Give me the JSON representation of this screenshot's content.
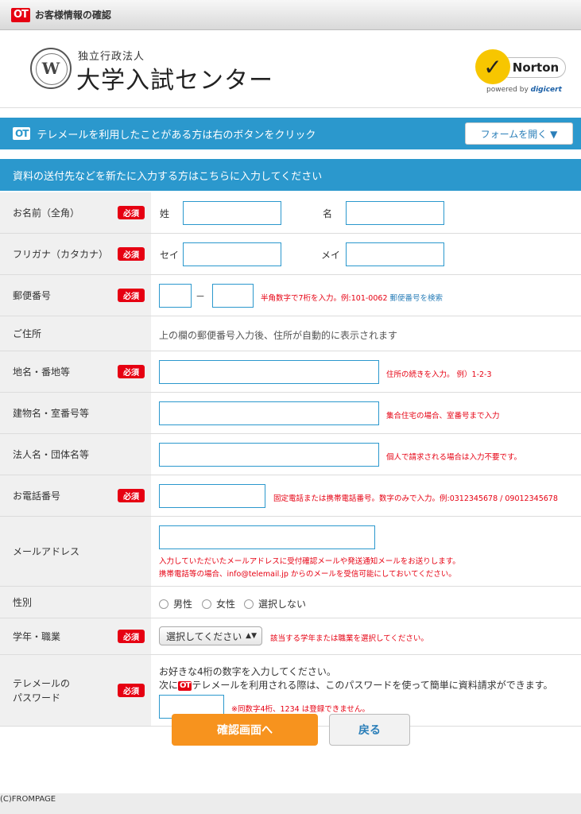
{
  "topbar": {
    "logo": "OT",
    "title": "お客様情報の確認"
  },
  "header": {
    "seal_mark": "W",
    "org_small": "独立行政法人",
    "org_big": "大学入試センター",
    "norton": {
      "name": "Norton",
      "powered": "powered by",
      "brand": "digicert"
    }
  },
  "telemail_bar": {
    "logo": "OT",
    "text": "テレメールを利用したことがある方は右のボタンをクリック",
    "button": "フォームを開く ▼"
  },
  "section_title": "資料の送付先などを新たに入力する方はこちらに入力してください",
  "required": "必須",
  "form": {
    "name": {
      "label": "お名前（全角）",
      "sei": "姓",
      "mei": "名"
    },
    "kana": {
      "label": "フリガナ（カタカナ）",
      "sei": "セイ",
      "mei": "メイ"
    },
    "postal": {
      "label": "郵便番号",
      "dash": "－",
      "note": "半角数字で7桁を入力。例:101-0062",
      "link": "郵便番号を検索"
    },
    "address": {
      "label": "ご住所",
      "text": "上の欄の郵便番号入力後、住所が自動的に表示されます"
    },
    "street": {
      "label": "地名・番地等",
      "note": "住所の続きを入力。 例）1-2-3"
    },
    "building": {
      "label": "建物名・室番号等",
      "note": "集合住宅の場合、室番号まで入力"
    },
    "company": {
      "label": "法人名・団体名等",
      "note": "個人で請求される場合は入力不要です。"
    },
    "phone": {
      "label": "お電話番号",
      "note": "固定電話または携帯電話番号。数字のみで入力。例:0312345678 / 09012345678"
    },
    "email": {
      "label": "メールアドレス",
      "note1": "入力していただいたメールアドレスに受付確認メールや発送通知メールをお送りします。",
      "note2": "携帯電話等の場合、info@telemail.jp からのメールを受信可能にしておいてください。"
    },
    "gender": {
      "label": "性別",
      "options": [
        "男性",
        "女性",
        "選択しない"
      ]
    },
    "grade": {
      "label": "学年・職業",
      "selected": "選択してください",
      "arrow": "▲▼",
      "note": "該当する学年または職業を選択してください。"
    },
    "password": {
      "label1": "テレメールの",
      "label2": "パスワード",
      "line1": "お好きな4桁の数字を入力してください。",
      "line2_a": "次に",
      "line2_logo": "OT",
      "line2_b": "テレメールを利用される際は、このパスワードを使って簡単に資料請求ができます。",
      "note": "※同数字4桁、1234 は登録できません。"
    }
  },
  "buttons": {
    "confirm": "確認画面へ",
    "back": "戻る"
  },
  "footer": "(C)FROMPAGE"
}
